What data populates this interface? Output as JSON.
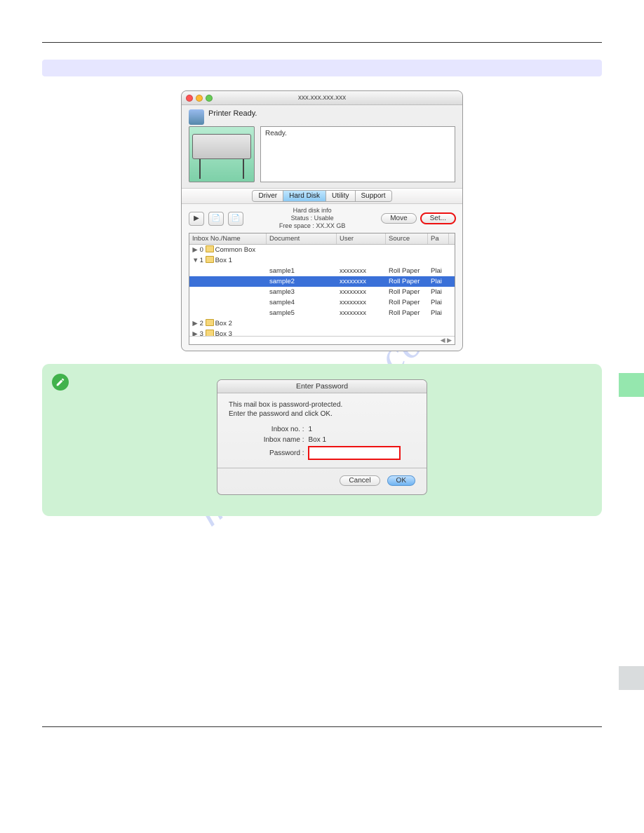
{
  "instruction": "",
  "window": {
    "title": "xxx.xxx.xxx.xxx",
    "status": "Printer Ready.",
    "ready": "Ready.",
    "tabs": {
      "driver": "Driver",
      "harddisk": "Hard Disk",
      "utility": "Utility",
      "support": "Support"
    },
    "hd": {
      "label": "Hard disk info",
      "status": "Status : Usable",
      "free": "Free space : XX.XX GB",
      "move": "Move",
      "set": "Set..."
    },
    "cols": {
      "c1": "Inbox No./Name",
      "c2": "Document",
      "c3": "User",
      "c4": "Source",
      "c5": "Pa"
    },
    "rows": {
      "g0": "0",
      "g0name": "Common Box",
      "g1": "1",
      "g1name": "Box 1",
      "s1": "sample1",
      "s2": "sample2",
      "s3": "sample3",
      "s4": "sample4",
      "s5": "sample5",
      "user": "xxxxxxxx",
      "source": "Roll Paper",
      "pa": "Plai",
      "g2": "2",
      "g2name": "Box 2",
      "g3": "3",
      "g3name": "Box 3"
    }
  },
  "note": {
    "line": ""
  },
  "dialog": {
    "title": "Enter Password",
    "intro1": "This mail box is password-protected.",
    "intro2": "Enter the password and click OK.",
    "inbox_no_label": "Inbox no. :",
    "inbox_no_val": "1",
    "inbox_name_label": "Inbox name :",
    "inbox_name_val": "Box 1",
    "password_label": "Password :",
    "cancel": "Cancel",
    "ok": "OK"
  },
  "watermark": "manualshive.com",
  "footer": {
    "left": "",
    "right": ""
  }
}
